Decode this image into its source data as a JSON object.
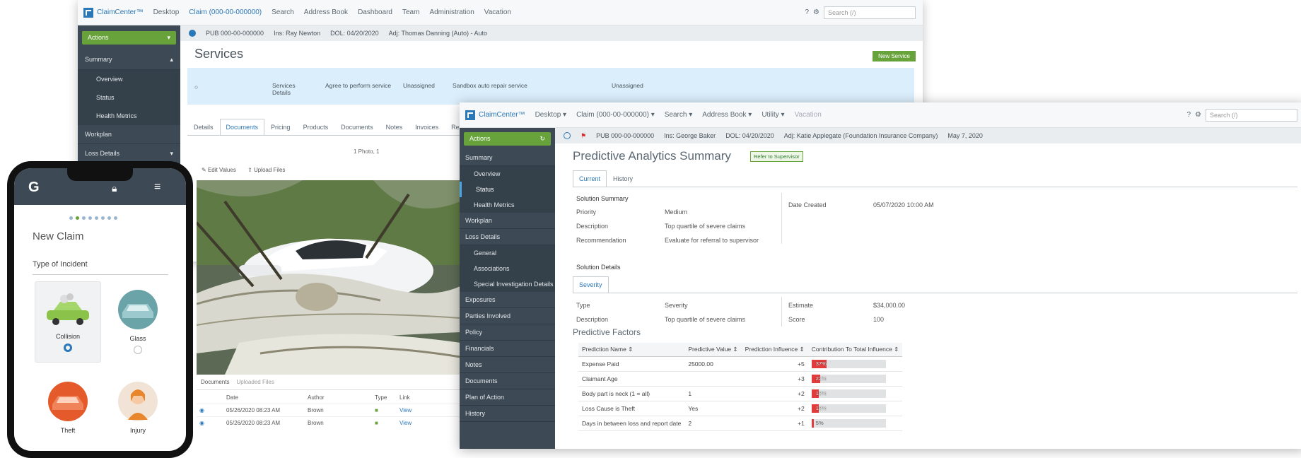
{
  "back_window": {
    "brand": "ClaimCenter™",
    "nav": [
      "Desktop",
      "Claim (000-00-000000)",
      "Search",
      "Address Book",
      "Dashboard",
      "Team",
      "Administration",
      "Vacation"
    ],
    "search_placeholder": "Search (/)",
    "actions_label": "Actions",
    "sidebar": [
      {
        "label": "Summary",
        "type": "head"
      },
      {
        "label": "Overview",
        "type": "sub"
      },
      {
        "label": "Status",
        "type": "sub"
      },
      {
        "label": "Health Metrics",
        "type": "sub"
      },
      {
        "label": "Workplan",
        "type": "head"
      },
      {
        "label": "Loss Details",
        "type": "head"
      }
    ],
    "infobar": [
      "PUB 000-00-000000",
      "Ins: Ray Newton",
      "DOL: 04/20/2020",
      "Adj: Thomas Danning (Auto) - Auto"
    ],
    "page_title": "Services",
    "primary_button": "New Service",
    "service_row": {
      "col1": "Services Details",
      "col2": "Agree to perform service",
      "col3": "Unassigned",
      "col4": "Sandbox auto repair service",
      "col5": "Unassigned"
    },
    "tabs": [
      "Details",
      "Documents",
      "Pricing",
      "Products",
      "Documents",
      "Notes",
      "Invoices",
      "Reviews"
    ],
    "tab_active": 1,
    "photo_caption": "1 Photo, 1",
    "photo_toolbar": [
      "Edit Values",
      "Upload Files"
    ],
    "docs_tabs": [
      "Documents",
      "Uploaded Files"
    ],
    "docs_headers": [
      "Date",
      "Author",
      "Type",
      "Link"
    ],
    "docs_rows": [
      {
        "date": "05/26/2020 08:23 AM",
        "author": "Brown",
        "link": "View"
      },
      {
        "date": "05/26/2020 08:23 AM",
        "author": "Brown",
        "link": "View"
      }
    ]
  },
  "front_window": {
    "brand": "ClaimCenter™",
    "nav": [
      "Desktop",
      "Claim (000-00-000000)",
      "Search",
      "Address Book",
      "Utility",
      "Vacation"
    ],
    "search_placeholder": "Search (/)",
    "actions_label": "Actions",
    "sidebar": [
      {
        "label": "Summary",
        "type": "head"
      },
      {
        "label": "Overview",
        "type": "sub"
      },
      {
        "label": "Status",
        "type": "sub",
        "active": true
      },
      {
        "label": "Health Metrics",
        "type": "sub"
      },
      {
        "label": "Workplan",
        "type": "head"
      },
      {
        "label": "Loss Details",
        "type": "head"
      },
      {
        "label": "General",
        "type": "sub"
      },
      {
        "label": "Associations",
        "type": "sub"
      },
      {
        "label": "Special Investigation Details",
        "type": "sub"
      },
      {
        "label": "Exposures",
        "type": "head"
      },
      {
        "label": "Parties Involved",
        "type": "head"
      },
      {
        "label": "Policy",
        "type": "head"
      },
      {
        "label": "Financials",
        "type": "head"
      },
      {
        "label": "Notes",
        "type": "head"
      },
      {
        "label": "Documents",
        "type": "head"
      },
      {
        "label": "Plan of Action",
        "type": "head"
      },
      {
        "label": "History",
        "type": "head"
      }
    ],
    "infobar": [
      "PUB 000-00-000000",
      "Ins: George Baker",
      "DOL: 04/20/2020",
      "Adj: Katie Applegate (Foundation Insurance Company)",
      "May 7, 2020"
    ],
    "page_title": "Predictive Analytics Summary",
    "title_badge": "Refer to Supervisor",
    "tabs": [
      "Current",
      "History"
    ],
    "tab_active": 0,
    "solution_summary_label": "Solution Summary",
    "summary_fields": [
      {
        "label": "Priority",
        "value": "Medium"
      },
      {
        "label": "Description",
        "value": "Top quartile of severe claims"
      },
      {
        "label": "Recommendation",
        "value": "Evaluate for referral to supervisor"
      }
    ],
    "date_created_label": "Date Created",
    "date_created_value": "05/07/2020 10:00 AM",
    "solution_details_label": "Solution Details",
    "detail_tab": "Severity",
    "detail_fields_left": [
      {
        "label": "Type",
        "value": "Severity"
      },
      {
        "label": "Description",
        "value": "Top quartile of severe claims"
      }
    ],
    "detail_fields_right": [
      {
        "label": "Estimate",
        "value": "$34,000.00"
      },
      {
        "label": "Score",
        "value": "100"
      }
    ],
    "predictive_factors_label": "Predictive Factors",
    "factors_headers": [
      "Prediction Name",
      "Predictive Value",
      "Prediction Influence",
      "Contribution To Total Influence"
    ],
    "factors": [
      {
        "name": "Expense Paid",
        "value": "25000.00",
        "influence": "+5",
        "contribution": 0.37,
        "contribution_label": "37%"
      },
      {
        "name": "Claimant Age",
        "value": "",
        "influence": "+3",
        "contribution": 0.22,
        "contribution_label": "22%"
      },
      {
        "name": "Body part is neck (1 = all)",
        "value": "1",
        "influence": "+2",
        "contribution": 0.18,
        "contribution_label": "18%"
      },
      {
        "name": "Loss Cause is Theft",
        "value": "Yes",
        "influence": "+2",
        "contribution": 0.18,
        "contribution_label": "18%"
      },
      {
        "name": "Days in between loss and report date",
        "value": "2",
        "influence": "+1",
        "contribution": 0.05,
        "contribution_label": "5%"
      }
    ]
  },
  "phone": {
    "title": "New Claim",
    "section": "Type of Incident",
    "options": [
      {
        "label": "Collision",
        "icon": "car-collision-icon"
      },
      {
        "label": "Glass",
        "icon": "glass-icon"
      },
      {
        "label": "Theft",
        "icon": "theft-icon"
      },
      {
        "label": "Injury",
        "icon": "injury-icon"
      }
    ],
    "steps": 8,
    "active_step": 1
  },
  "colors": {
    "brand_blue": "#2b78b8",
    "sidebar": "#3d4a55",
    "action_green": "#67a23b",
    "influence_red": "#e23b3b"
  }
}
